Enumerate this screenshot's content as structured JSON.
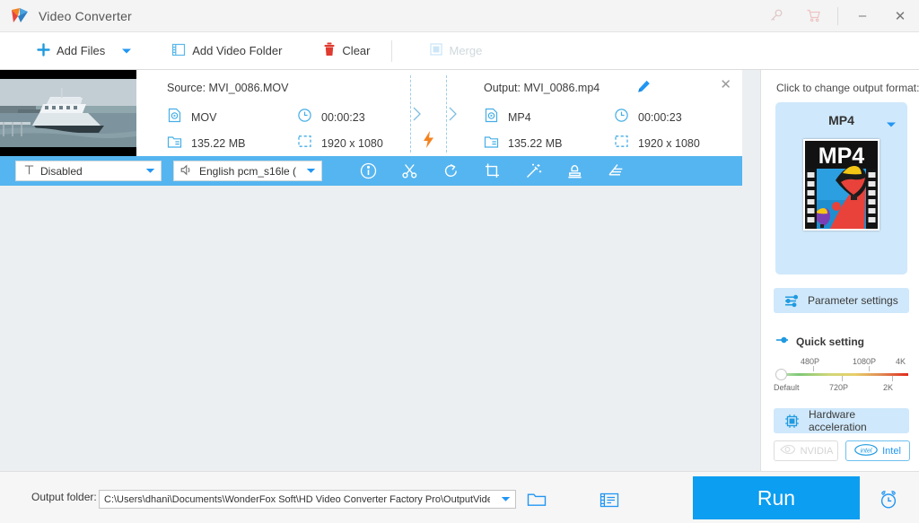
{
  "window": {
    "title": "Video Converter",
    "icons": {
      "register": "key-icon",
      "buy": "cart-icon",
      "minimize": "–",
      "close": "✕"
    }
  },
  "toolbar": {
    "add_files": "Add Files",
    "add_files_caret": "chevron-down-icon",
    "add_video_folder": "Add Video Folder",
    "clear": "Clear",
    "merge": "Merge"
  },
  "file_card": {
    "source": {
      "title": "Source: MVI_0086.MOV",
      "format": "MOV",
      "duration": "00:00:23",
      "size": "135.22 MB",
      "resolution": "1920 x 1080"
    },
    "output": {
      "title": "Output: MVI_0086.mp4",
      "format": "MP4",
      "duration": "00:00:23",
      "size": "135.22 MB",
      "resolution": "1920 x 1080"
    },
    "close": "✕"
  },
  "edit_strip": {
    "subtitle_select": "Disabled",
    "audio_select": "English pcm_s16le (",
    "tools": [
      {
        "name": "info-icon",
        "label": "Information"
      },
      {
        "name": "scissors-icon",
        "label": "Cut"
      },
      {
        "name": "rotate-icon",
        "label": "Rotate"
      },
      {
        "name": "crop-icon",
        "label": "Crop"
      },
      {
        "name": "magic-wand-icon",
        "label": "Effects"
      },
      {
        "name": "stamp-icon",
        "label": "Watermark"
      },
      {
        "name": "subtitle-icon",
        "label": "Subtitle"
      }
    ]
  },
  "right_panel": {
    "hint": "Click to change output format:",
    "format_name": "MP4",
    "format_thumb_label": "MP4",
    "parameter_settings": "Parameter settings",
    "quick_setting": "Quick setting",
    "slider": {
      "top_labels": [
        "480P",
        "1080P",
        "4K"
      ],
      "bottom_labels": [
        "Default",
        "720P",
        "2K"
      ],
      "value": "Default"
    },
    "hardware_acceleration": "Hardware acceleration",
    "gpus": [
      {
        "name": "NVIDIA",
        "active": false
      },
      {
        "name": "Intel",
        "active": true
      }
    ]
  },
  "bottom": {
    "output_folder_label": "Output folder:",
    "output_folder_value": "C:\\Users\\dhani\\Documents\\WonderFox Soft\\HD Video Converter Factory Pro\\OutputVideo\\",
    "open_folder_icon": "folder-icon",
    "video_list_icon": "video-file-icon",
    "run_label": "Run",
    "schedule_icon": "alarm-clock-icon"
  },
  "colors": {
    "accent": "#0c9ef0",
    "strip": "#55b5f0",
    "panel_tint": "#cfe8fb",
    "bolt": "#f5821f"
  }
}
